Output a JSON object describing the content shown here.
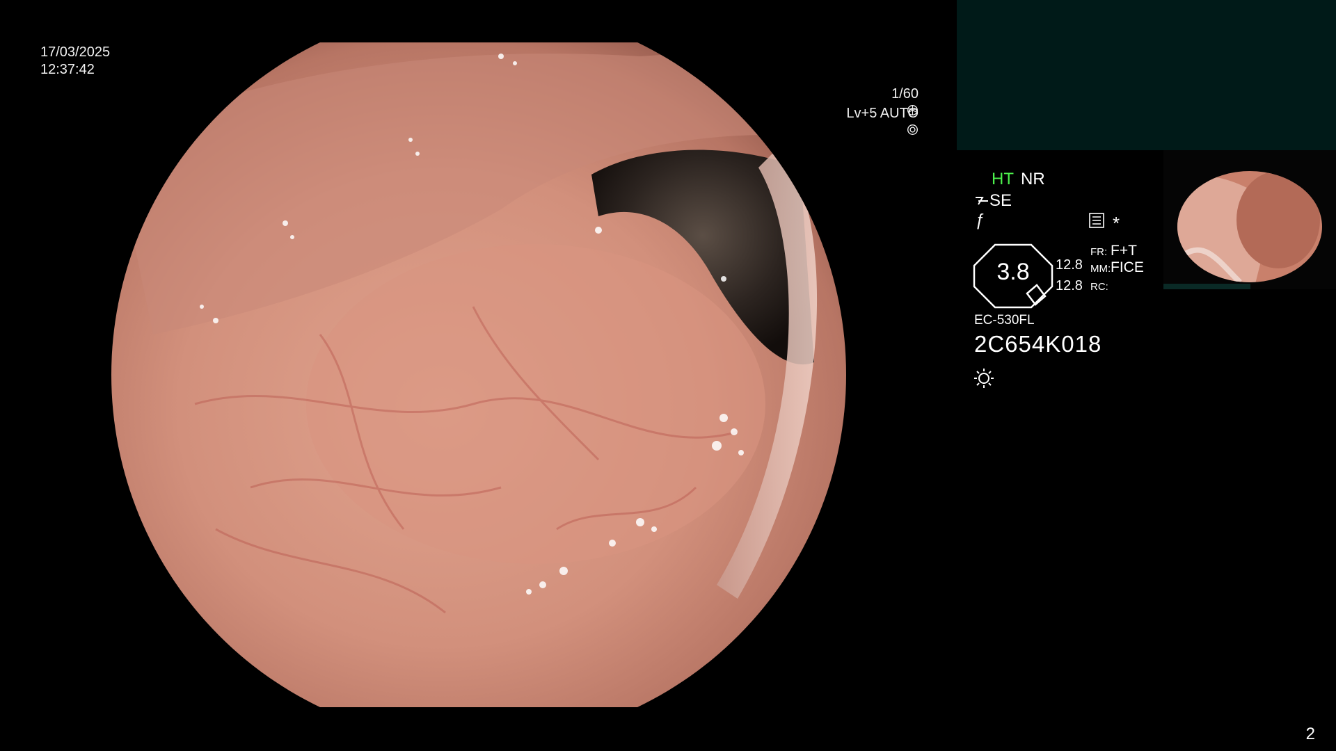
{
  "overlay": {
    "date": "17/03/2025",
    "time": "12:37:42",
    "shutter": "1/60",
    "brightness": "Lv+5 AUTO",
    "shutter_icon": "aperture-icon",
    "iris_icon": "iris-icon"
  },
  "panel": {
    "ht": "HT",
    "nr": "NR",
    "se": "SE",
    "f_mark": "ƒ",
    "star": "*",
    "zoom_value": "3.8",
    "values": [
      "12.8",
      "12.8"
    ],
    "fr_label": "FR:",
    "fr_value": "F+T",
    "mm_label": "MM:",
    "mm_value": "FICE",
    "rc_label": "RC:",
    "scope_model": "EC-530FL",
    "serial": "2C654K018"
  },
  "footer": {
    "page_number": "2"
  },
  "colors": {
    "ht_accent": "#4cf04c",
    "teal_panel": "#001a18",
    "tissue": "#d99a88"
  }
}
